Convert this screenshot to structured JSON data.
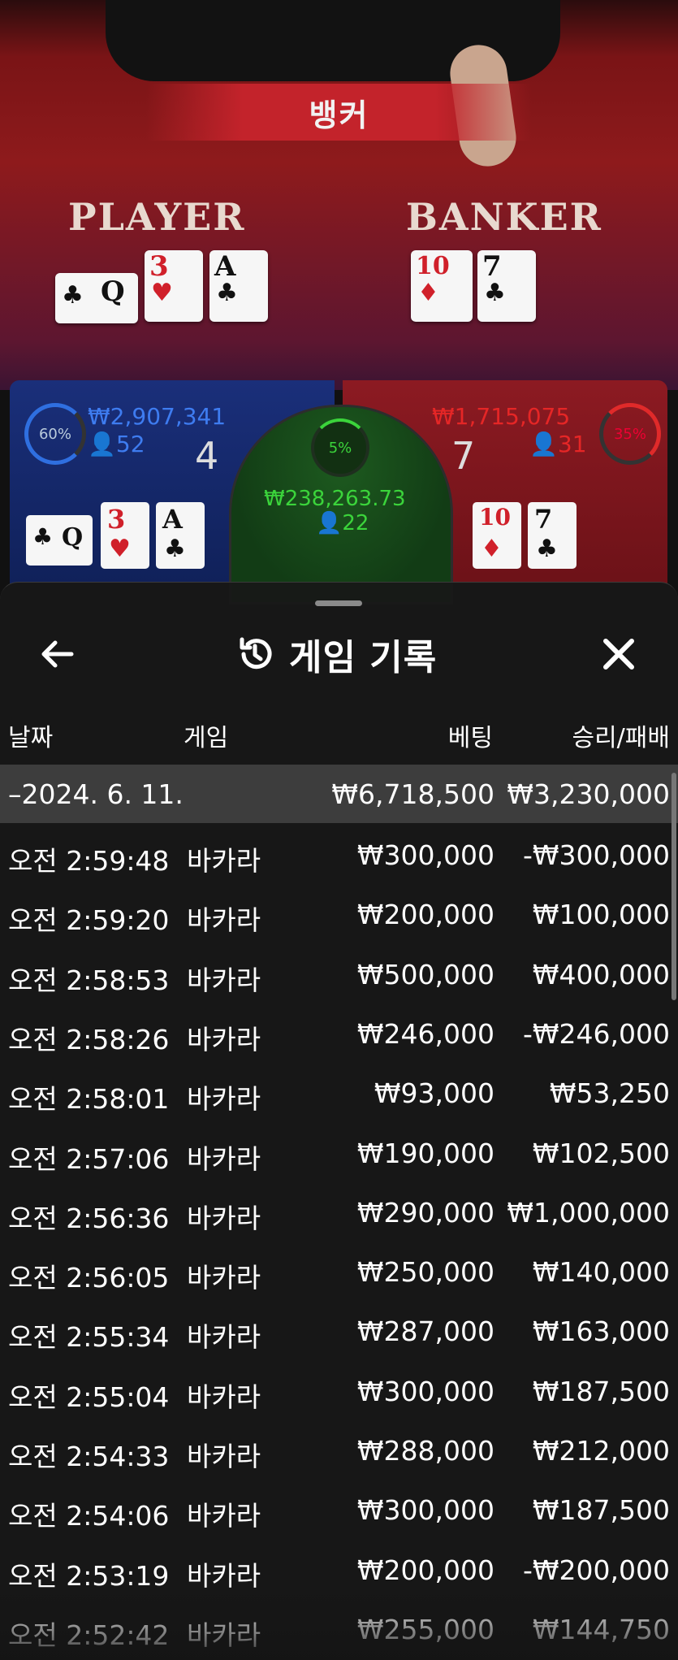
{
  "live_view": {
    "result_banner": "뱅커",
    "player_label": "PLAYER",
    "banker_label": "BANKER",
    "player_cards": [
      {
        "rank": "Q",
        "suit": "♣",
        "color": "black"
      },
      {
        "rank": "3",
        "suit": "♥",
        "color": "red"
      },
      {
        "rank": "A",
        "suit": "♣",
        "color": "black"
      }
    ],
    "banker_cards": [
      {
        "rank": "10",
        "suit": "♦",
        "color": "red"
      },
      {
        "rank": "7",
        "suit": "♣",
        "color": "black"
      }
    ]
  },
  "board": {
    "player": {
      "percent": "60%",
      "amount": "₩2,907,341",
      "count": "52",
      "score": "4"
    },
    "banker": {
      "percent": "35%",
      "amount": "₩1,715,075",
      "count": "31",
      "score": "7"
    },
    "tie": {
      "percent": "5%",
      "amount": "₩238,263.73",
      "count": "22"
    },
    "player_mini_cards": [
      {
        "rank": "Q",
        "suit": "♣",
        "color": "black"
      },
      {
        "rank": "3",
        "suit": "♥",
        "color": "red"
      },
      {
        "rank": "A",
        "suit": "♣",
        "color": "black"
      }
    ],
    "banker_mini_cards": [
      {
        "rank": "10",
        "suit": "♦",
        "color": "red"
      },
      {
        "rank": "7",
        "suit": "♣",
        "color": "black"
      }
    ]
  },
  "sheet": {
    "title": "게임 기록",
    "columns": {
      "date": "날짜",
      "game": "게임",
      "bet": "베팅",
      "win_loss": "승리/패배"
    },
    "summary": {
      "date": "–2024. 6. 11.",
      "bet": "₩6,718,500",
      "win_loss": "₩3,230,000"
    },
    "rows": [
      {
        "time": "오전 2:59:48",
        "game": "바카라",
        "bet": "₩300,000",
        "win_loss": "-₩300,000"
      },
      {
        "time": "오전 2:59:20",
        "game": "바카라",
        "bet": "₩200,000",
        "win_loss": "₩100,000"
      },
      {
        "time": "오전 2:58:53",
        "game": "바카라",
        "bet": "₩500,000",
        "win_loss": "₩400,000"
      },
      {
        "time": "오전 2:58:26",
        "game": "바카라",
        "bet": "₩246,000",
        "win_loss": "-₩246,000"
      },
      {
        "time": "오전 2:58:01",
        "game": "바카라",
        "bet": "₩93,000",
        "win_loss": "₩53,250"
      },
      {
        "time": "오전 2:57:06",
        "game": "바카라",
        "bet": "₩190,000",
        "win_loss": "₩102,500"
      },
      {
        "time": "오전 2:56:36",
        "game": "바카라",
        "bet": "₩290,000",
        "win_loss": "₩1,000,000"
      },
      {
        "time": "오전 2:56:05",
        "game": "바카라",
        "bet": "₩250,000",
        "win_loss": "₩140,000"
      },
      {
        "time": "오전 2:55:34",
        "game": "바카라",
        "bet": "₩287,000",
        "win_loss": "₩163,000"
      },
      {
        "time": "오전 2:55:04",
        "game": "바카라",
        "bet": "₩300,000",
        "win_loss": "₩187,500"
      },
      {
        "time": "오전 2:54:33",
        "game": "바카라",
        "bet": "₩288,000",
        "win_loss": "₩212,000"
      },
      {
        "time": "오전 2:54:06",
        "game": "바카라",
        "bet": "₩300,000",
        "win_loss": "₩187,500"
      },
      {
        "time": "오전 2:53:19",
        "game": "바카라",
        "bet": "₩200,000",
        "win_loss": "-₩200,000"
      },
      {
        "time": "오전 2:52:42",
        "game": "바카라",
        "bet": "₩255,000",
        "win_loss": "₩144,750"
      }
    ]
  },
  "colors": {
    "player_blue": "#1a2f7a",
    "banker_red": "#8c1a22",
    "tie_green": "#1d5a1f",
    "sheet_bg": "#181818",
    "summary_bg": "#3d3d3d"
  }
}
